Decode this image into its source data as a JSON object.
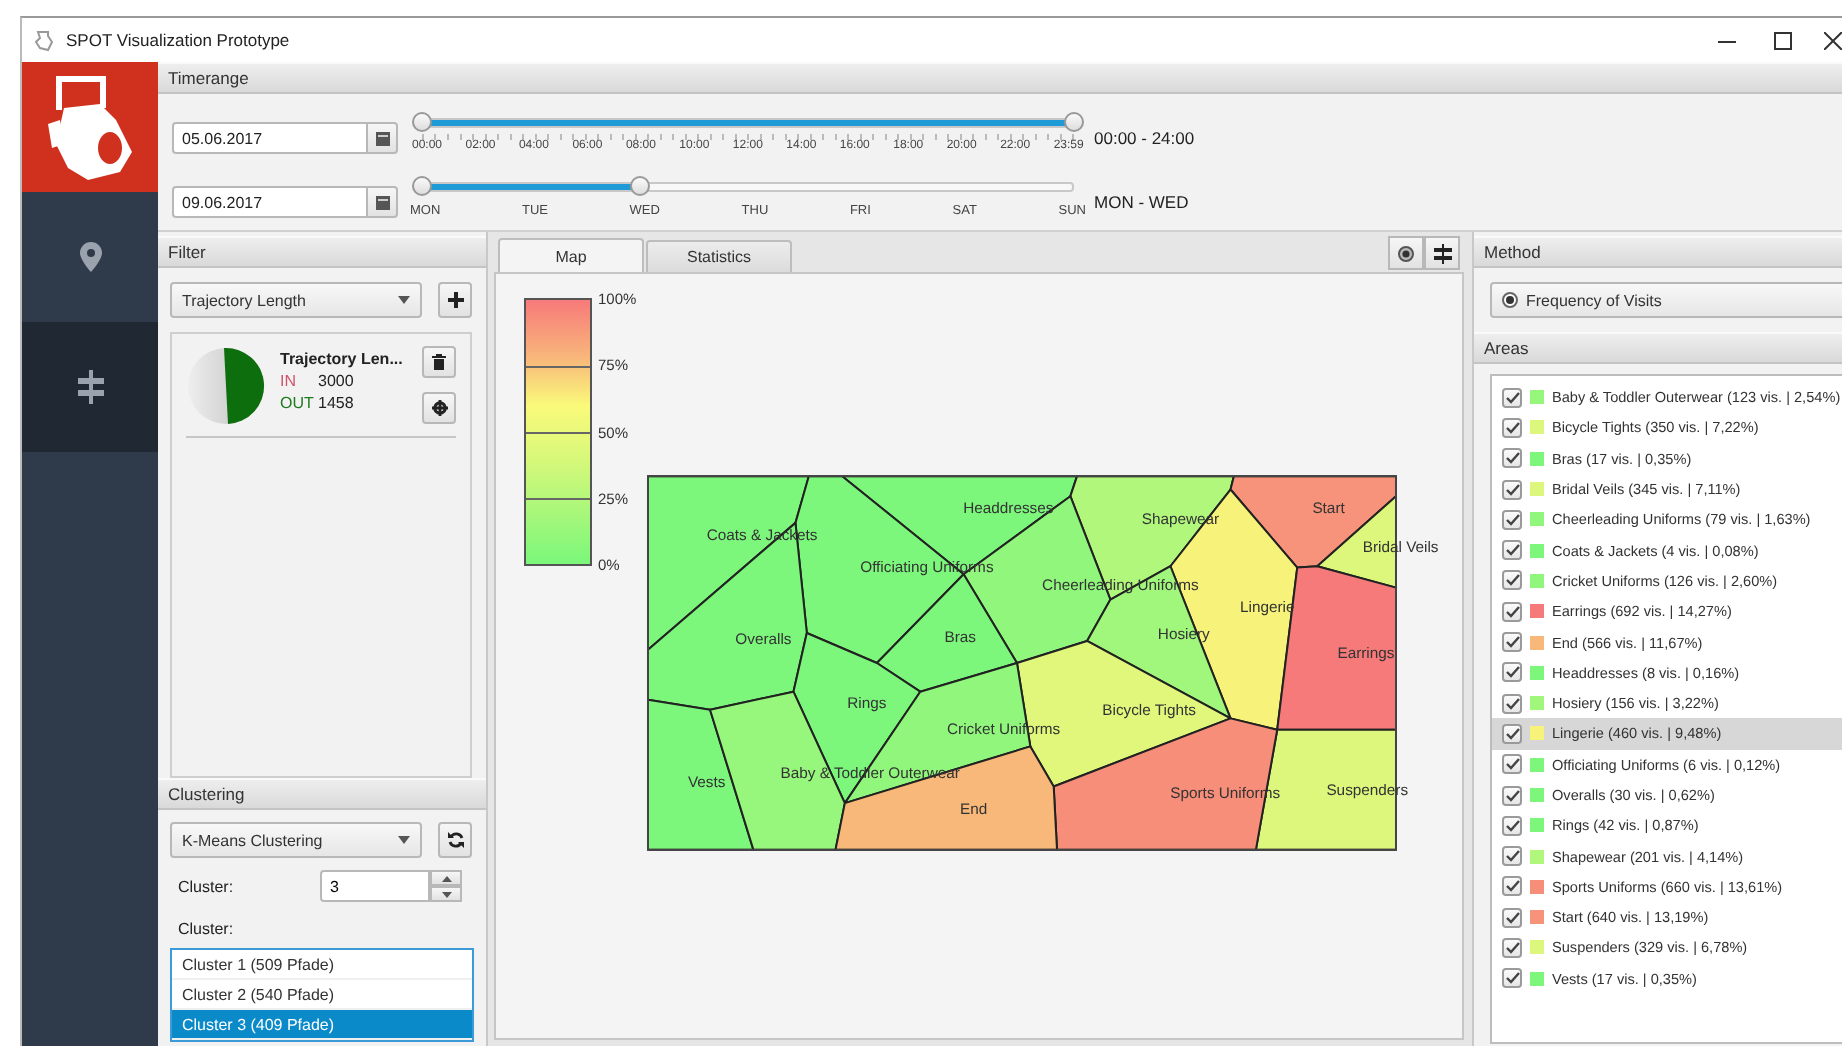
{
  "window": {
    "title": "SPOT Visualization Prototype"
  },
  "sidebar": {
    "items": [
      {
        "kind": "pin",
        "selected": false
      },
      {
        "kind": "signpost",
        "selected": true
      }
    ]
  },
  "timerange": {
    "title": "Timerange",
    "rows": [
      {
        "kind": "time",
        "date": "05.06.2017",
        "ticks": [
          "00:00",
          "02:00",
          "04:00",
          "06:00",
          "08:00",
          "10:00",
          "12:00",
          "14:00",
          "16:00",
          "18:00",
          "20:00",
          "22:00",
          "23:59"
        ],
        "level": 1,
        "reading": "00:00 - 24:00"
      },
      {
        "kind": "day",
        "date": "09.06.2017",
        "ticks": [
          "MON",
          "TUE",
          "WED",
          "THU",
          "FRI",
          "SAT",
          "SUN"
        ],
        "level": 0.333,
        "reading": "MON - WED"
      }
    ]
  },
  "filter": {
    "title": "Filter",
    "dropdown": "Trajectory Length",
    "cards": [
      {
        "title": "Trajectory Len...",
        "in_label": "IN",
        "in_value": "3000",
        "out_label": "OUT",
        "out_value": "1458"
      }
    ]
  },
  "clustering": {
    "title": "Clustering",
    "method": "K-Means Clustering",
    "count_label": "Cluster:",
    "count": "3",
    "list_label": "Cluster:",
    "clusters": [
      {
        "label": "Cluster 1 (509 Pfade)",
        "selected": false
      },
      {
        "label": "Cluster 2 (540 Pfade)",
        "selected": false
      },
      {
        "label": "Cluster 3 (409 Pfade)",
        "selected": true
      }
    ]
  },
  "tabs": [
    {
      "label": "Map",
      "selected": true
    },
    {
      "label": "Statistics",
      "selected": false
    }
  ],
  "legend": {
    "ticks": [
      "100%",
      "75%",
      "50%",
      "25%",
      "0%"
    ]
  },
  "map": {
    "regions": [
      {
        "label": "Coats & Jackets",
        "color": "#7cf77c"
      },
      {
        "label": "Headdresses",
        "color": "#7cf77c"
      },
      {
        "label": "Shapewear",
        "color": "#b0f77c"
      },
      {
        "label": "Start",
        "color": "#f7937a"
      },
      {
        "label": "Bridal Veils",
        "color": "#dcf77c"
      },
      {
        "label": "Officiating Uniforms",
        "color": "#7cf77c"
      },
      {
        "label": "Cheerleading Uniforms",
        "color": "#90f77c"
      },
      {
        "label": "Lingerie",
        "color": "#f7f27a"
      },
      {
        "label": "Overalls",
        "color": "#7cf77c"
      },
      {
        "label": "Bras",
        "color": "#7cf77c"
      },
      {
        "label": "Hosiery",
        "color": "#a0f77c"
      },
      {
        "label": "Earrings",
        "color": "#f77a7a"
      },
      {
        "label": "Rings",
        "color": "#7cf77c"
      },
      {
        "label": "Bicycle Tights",
        "color": "#e0f77c"
      },
      {
        "label": "Cricket Uniforms",
        "color": "#90f77c"
      },
      {
        "label": "Vests",
        "color": "#7cf77c"
      },
      {
        "label": "Baby & Toddler Outerwear",
        "color": "#96f77c"
      },
      {
        "label": "Suspenders",
        "color": "#dcf77c"
      },
      {
        "label": "Sports Uniforms",
        "color": "#f78e7a"
      },
      {
        "label": "End",
        "color": "#f7b87a"
      }
    ]
  },
  "method": {
    "title": "Method",
    "selected": "Frequency of Visits"
  },
  "areas": {
    "title": "Areas",
    "items": [
      {
        "label": "Baby & Toddler Outerwear (123 vis. | 2,54%)",
        "color": "#96f77c",
        "checked": true,
        "selected": false
      },
      {
        "label": "Bicycle Tights (350 vis. | 7,22%)",
        "color": "#dcf77c",
        "checked": true,
        "selected": false
      },
      {
        "label": "Bras (17 vis. | 0,35%)",
        "color": "#7cf77c",
        "checked": true,
        "selected": false
      },
      {
        "label": "Bridal Veils (345 vis. | 7,11%)",
        "color": "#dcf77c",
        "checked": true,
        "selected": false
      },
      {
        "label": "Cheerleading Uniforms (79 vis. | 1,63%)",
        "color": "#90f77c",
        "checked": true,
        "selected": false
      },
      {
        "label": "Coats & Jackets (4 vis. | 0,08%)",
        "color": "#7cf77c",
        "checked": true,
        "selected": false
      },
      {
        "label": "Cricket Uniforms (126 vis. | 2,60%)",
        "color": "#90f77c",
        "checked": true,
        "selected": false
      },
      {
        "label": "Earrings (692 vis. | 14,27%)",
        "color": "#f77a7a",
        "checked": true,
        "selected": false
      },
      {
        "label": "End (566 vis. | 11,67%)",
        "color": "#f7b87a",
        "checked": true,
        "selected": false
      },
      {
        "label": "Headdresses (8 vis. | 0,16%)",
        "color": "#7cf77c",
        "checked": true,
        "selected": false
      },
      {
        "label": "Hosiery (156 vis. | 3,22%)",
        "color": "#a0f77c",
        "checked": true,
        "selected": false
      },
      {
        "label": "Lingerie (460 vis. | 9,48%)",
        "color": "#f7f27a",
        "checked": true,
        "selected": true
      },
      {
        "label": "Officiating Uniforms (6 vis. | 0,12%)",
        "color": "#7cf77c",
        "checked": true,
        "selected": false
      },
      {
        "label": "Overalls (30 vis. | 0,62%)",
        "color": "#7cf77c",
        "checked": true,
        "selected": false
      },
      {
        "label": "Rings (42 vis. | 0,87%)",
        "color": "#7cf77c",
        "checked": true,
        "selected": false
      },
      {
        "label": "Shapewear (201 vis. | 4,14%)",
        "color": "#b0f77c",
        "checked": true,
        "selected": false
      },
      {
        "label": "Sports Uniforms (660 vis. | 13,61%)",
        "color": "#f78e7a",
        "checked": true,
        "selected": false
      },
      {
        "label": "Start (640 vis. | 13,19%)",
        "color": "#f7937a",
        "checked": true,
        "selected": false
      },
      {
        "label": "Suspenders (329 vis. | 6,78%)",
        "color": "#dcf77c",
        "checked": true,
        "selected": false
      },
      {
        "label": "Vests (17 vis. | 0,35%)",
        "color": "#7cf77c",
        "checked": true,
        "selected": false
      }
    ]
  }
}
